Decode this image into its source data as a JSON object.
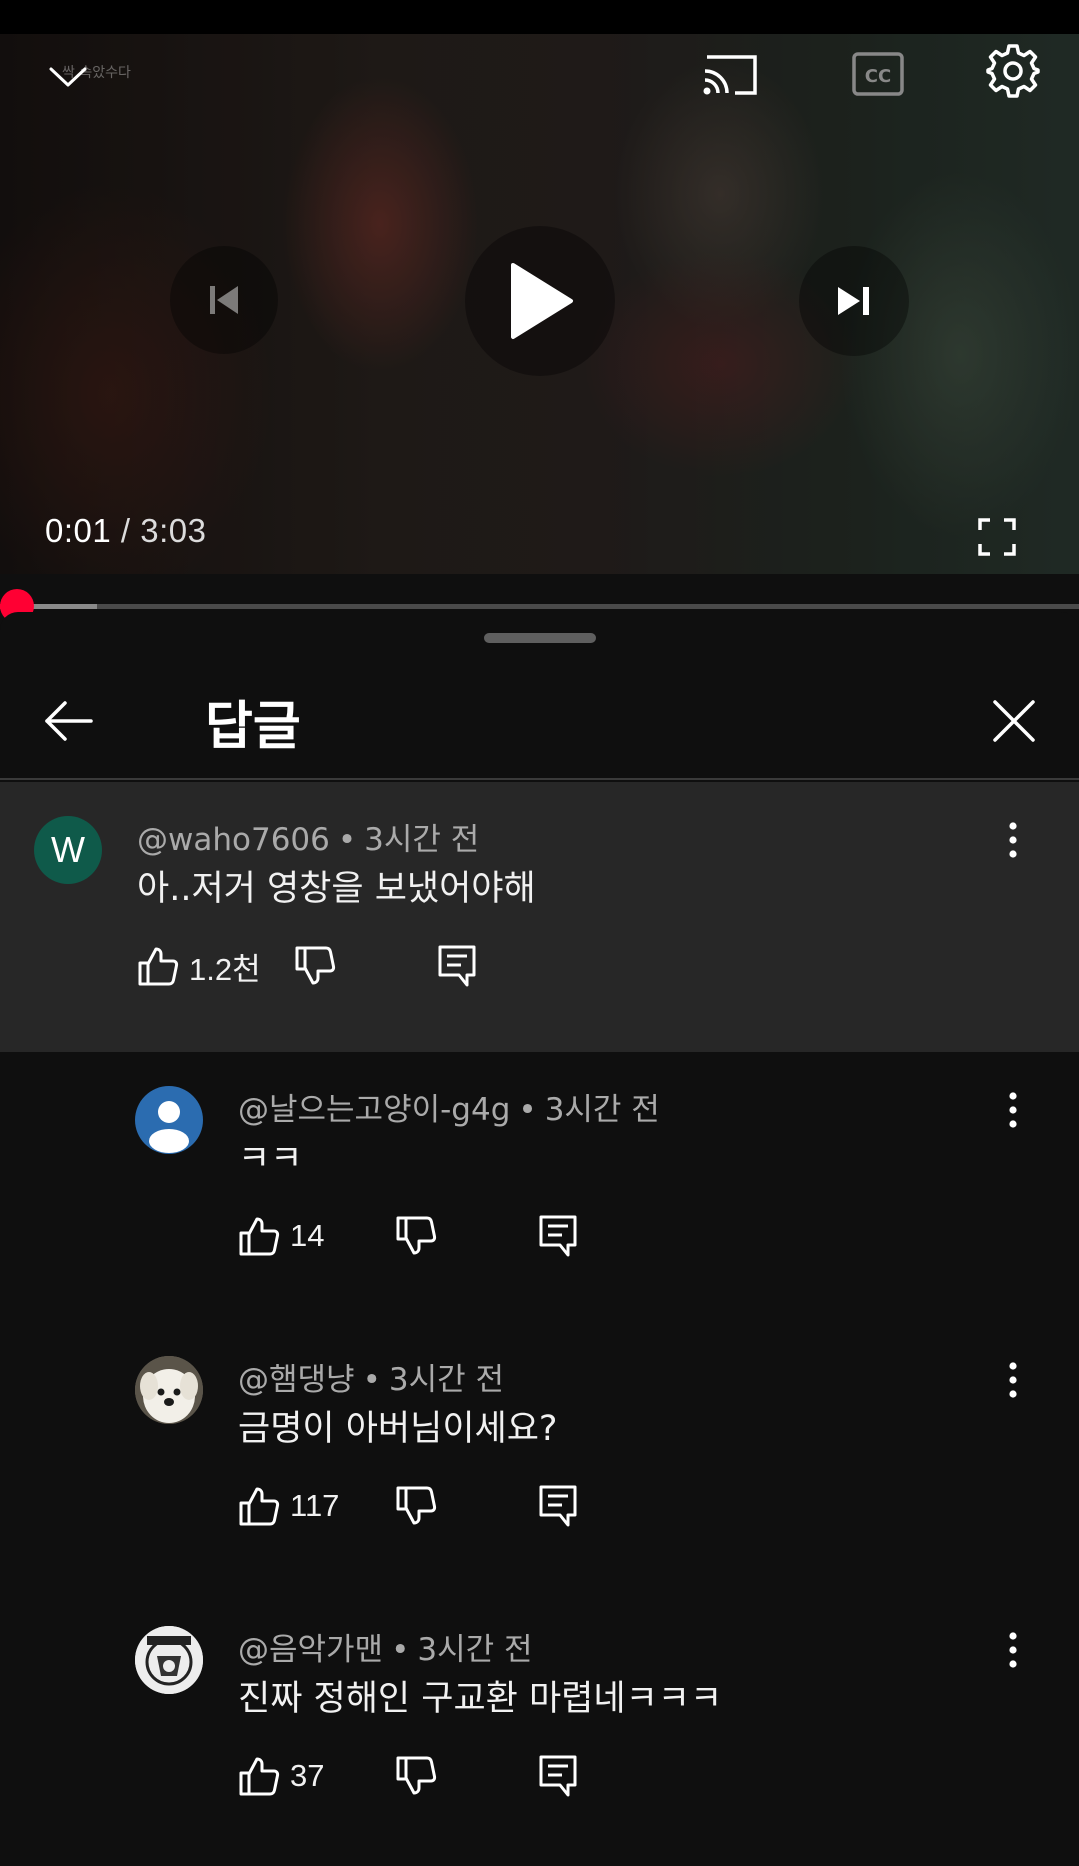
{
  "player": {
    "watermark": "싹 속았수다",
    "current_time": "0:01",
    "separator": " / ",
    "duration": "3:03",
    "played_fraction": 0.005,
    "buffered_fraction": 0.09,
    "controls": [
      "collapse",
      "cast",
      "captions",
      "settings",
      "previous",
      "play",
      "next",
      "fullscreen"
    ]
  },
  "panel": {
    "title": "답글"
  },
  "comments": [
    {
      "author": "@waho7606",
      "time": "3시간 전",
      "text": "아..저거 영창을 보냈어야해",
      "likes": "1.2천",
      "avatar": {
        "kind": "letter",
        "letter": "W",
        "color": "#0f5a4a"
      }
    },
    {
      "author": "@날으는고양이-g4g",
      "time": "3시간 전",
      "text": "ㅋㅋ",
      "likes": "14",
      "avatar": {
        "kind": "default-person",
        "color": "#2b6cb0"
      }
    },
    {
      "author": "@햄댕냥",
      "time": "3시간 전",
      "text": "금명이 아버님이세요?",
      "likes": "117",
      "avatar": {
        "kind": "photo-dog"
      }
    },
    {
      "author": "@음악가맨",
      "time": "3시간 전",
      "text": "진짜 정해인 구교환 마렵네ㅋㅋㅋ",
      "likes": "37",
      "avatar": {
        "kind": "photo-logo"
      }
    }
  ],
  "colors": {
    "accent": "#ff0033",
    "background": "#0f0f0f",
    "highlight": "#272727",
    "secondary_text": "#aaaaaa"
  }
}
